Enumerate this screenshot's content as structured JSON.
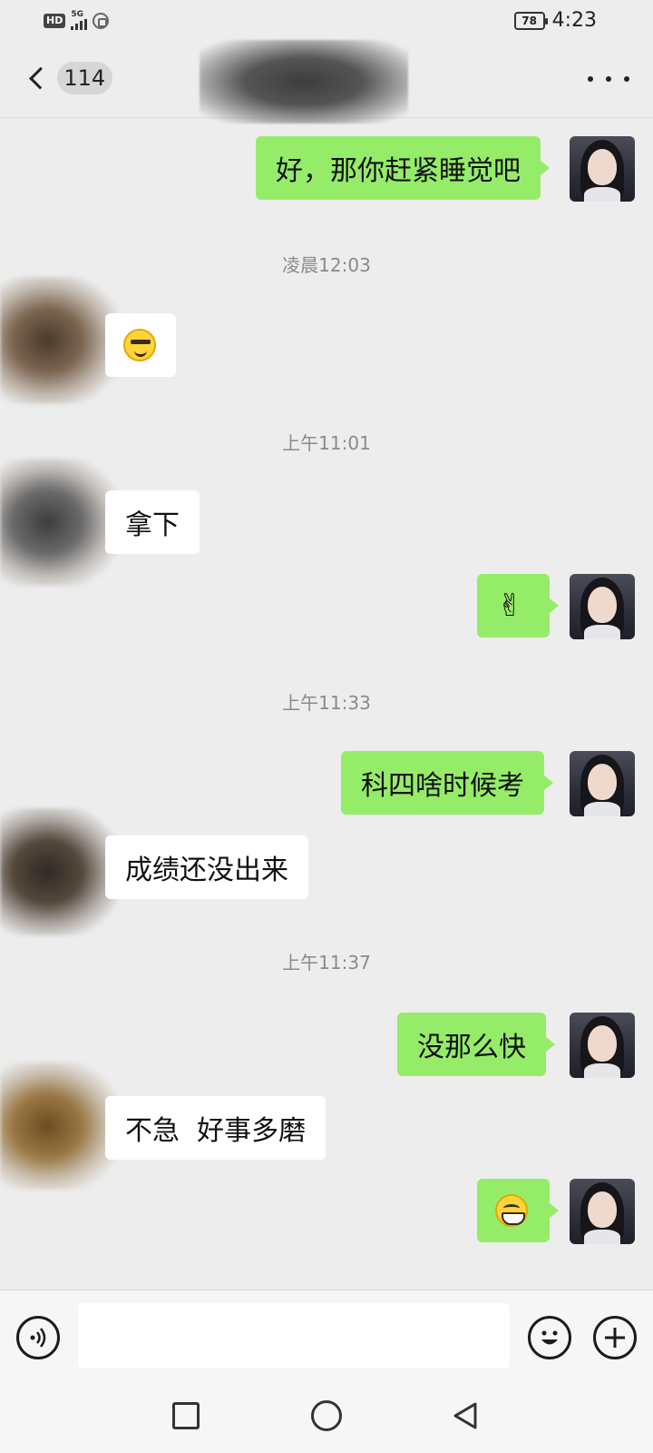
{
  "status_bar": {
    "hd": "HD",
    "network": "5G",
    "battery": "78",
    "time": "4:23",
    "icons": [
      "hd-badge",
      "signal-icon",
      "nfc-icon",
      "battery-icon"
    ]
  },
  "header": {
    "back_icon": "chevron-left-icon",
    "unread_count": "114",
    "more_icon": "more-dots-icon"
  },
  "messages": [
    {
      "side": "me",
      "text": "好，那你赶紧睡觉吧"
    },
    {
      "type": "time",
      "text": "凌晨12:03"
    },
    {
      "side": "other",
      "emoji": "smirk-emoji"
    },
    {
      "type": "time",
      "text": "上午11:01"
    },
    {
      "side": "other",
      "text": "拿下"
    },
    {
      "side": "me",
      "emoji": "victory-hand-emoji",
      "text": "✌"
    },
    {
      "type": "time",
      "text": "上午11:33"
    },
    {
      "side": "me",
      "text": "科四啥时候考"
    },
    {
      "side": "other",
      "text": "成绩还没出来"
    },
    {
      "type": "time",
      "text": "上午11:37"
    },
    {
      "side": "me",
      "text": "没那么快"
    },
    {
      "side": "other",
      "text": "不急  好事多磨"
    },
    {
      "side": "me",
      "emoji": "grin-emoji"
    }
  ],
  "input_bar": {
    "voice_icon": "voice-icon",
    "placeholder": "",
    "emoji_icon": "smile-icon",
    "plus_icon": "plus-icon"
  },
  "nav": {
    "recent_icon": "square-icon",
    "home_icon": "circle-icon",
    "back_icon": "triangle-back-icon"
  },
  "colors": {
    "background": "#ededed",
    "my_bubble": "#95ec69",
    "their_bubble": "#ffffff",
    "timestamp_text": "#8a8a8a"
  }
}
